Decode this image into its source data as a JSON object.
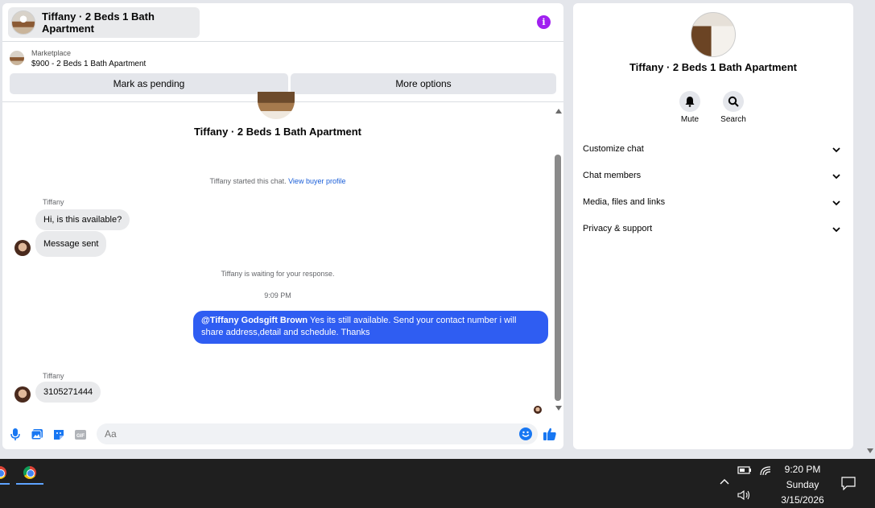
{
  "chat": {
    "title": "Tiffany · 2 Beds 1 Bath Apartment",
    "marketplace_label": "Marketplace",
    "listing": "$900 - 2 Beds 1 Bath Apartment",
    "mark_pending_label": "Mark as pending",
    "more_options_label": "More options",
    "hero_name": "Tiffany · 2 Beds 1 Bath Apartment",
    "started_text": "Tiffany started this chat.",
    "view_profile_label": "View buyer profile",
    "sender_1": "Tiffany",
    "msg_1": "Hi, is this available?",
    "msg_2": "Message sent",
    "waiting_text": "Tiffany is waiting for your response.",
    "time": "9:09 PM",
    "out_mention": "@Tiffany Godsgift Brown",
    "out_text": " Yes its still available. Send your contact number i will share address,detail and schedule. Thanks",
    "sender_2": "Tiffany",
    "msg_3": "3105271444",
    "input_placeholder": "Aa"
  },
  "info": {
    "name": "Tiffany · 2 Beds 1 Bath Apartment",
    "mute_label": "Mute",
    "search_label": "Search",
    "sections": [
      "Customize chat",
      "Chat members",
      "Media, files and links",
      "Privacy & support"
    ]
  },
  "taskbar": {
    "time": "9:20 PM",
    "day": "Sunday",
    "date": "3/15/2026"
  },
  "colors": {
    "accent": "#2f5df2",
    "info_icon": "#a020f0",
    "like": "#1877f2"
  }
}
